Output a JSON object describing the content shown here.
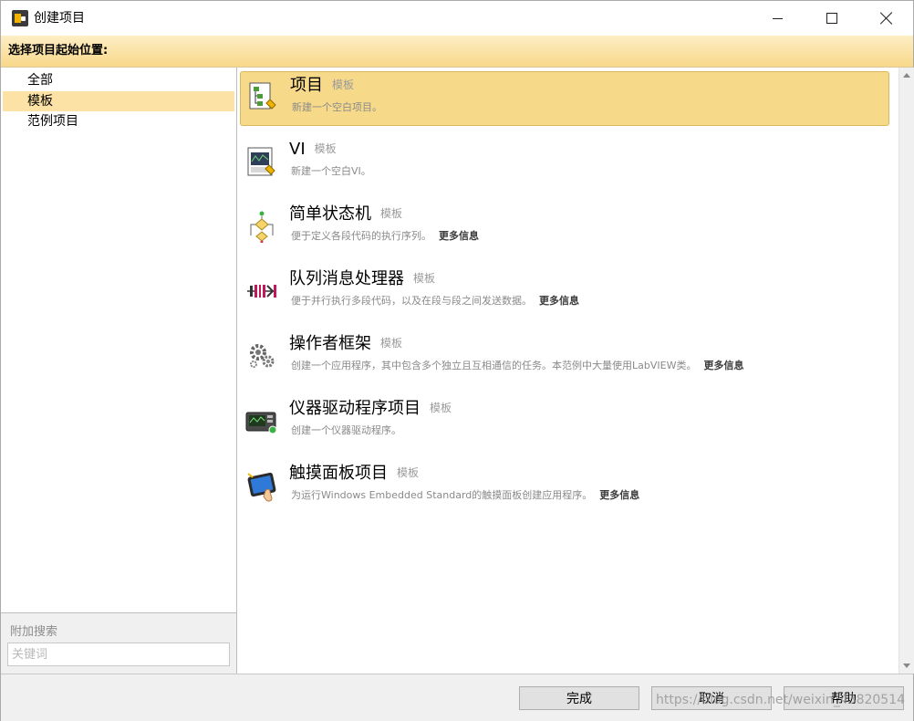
{
  "window": {
    "title": "创建项目"
  },
  "header": {
    "label": "选择项目起始位置:"
  },
  "categories": [
    {
      "label": "全部"
    },
    {
      "label": "模板"
    },
    {
      "label": "范例项目"
    }
  ],
  "search": {
    "label": "附加搜索",
    "placeholder": "关键词"
  },
  "templates": [
    {
      "name": "项目",
      "tag": "模板",
      "desc": "新建一个空白项目。",
      "more": "",
      "icon": "project-icon"
    },
    {
      "name": "VI",
      "tag": "模板",
      "desc": "新建一个空白VI。",
      "more": "",
      "icon": "vi-icon"
    },
    {
      "name": "简单状态机",
      "tag": "模板",
      "desc": "便于定义各段代码的执行序列。",
      "more": "更多信息",
      "icon": "state-machine-icon"
    },
    {
      "name": "队列消息处理器",
      "tag": "模板",
      "desc": "便于并行执行多段代码，以及在段与段之间发送数据。",
      "more": "更多信息",
      "icon": "queue-icon"
    },
    {
      "name": "操作者框架",
      "tag": "模板",
      "desc": "创建一个应用程序，其中包含多个独立且互相通信的任务。本范例中大量使用LabVIEW类。",
      "more": "更多信息",
      "icon": "gears-icon"
    },
    {
      "name": "仪器驱动程序项目",
      "tag": "模板",
      "desc": "创建一个仪器驱动程序。",
      "more": "",
      "icon": "instrument-icon"
    },
    {
      "name": "触摸面板项目",
      "tag": "模板",
      "desc": "为运行Windows Embedded Standard的触摸面板创建应用程序。",
      "more": "更多信息",
      "icon": "touch-panel-icon"
    }
  ],
  "buttons": {
    "finish": "完成",
    "cancel": "取消",
    "help": "帮助"
  },
  "watermark": "https://blog.csdn.net/weixin_43820514"
}
